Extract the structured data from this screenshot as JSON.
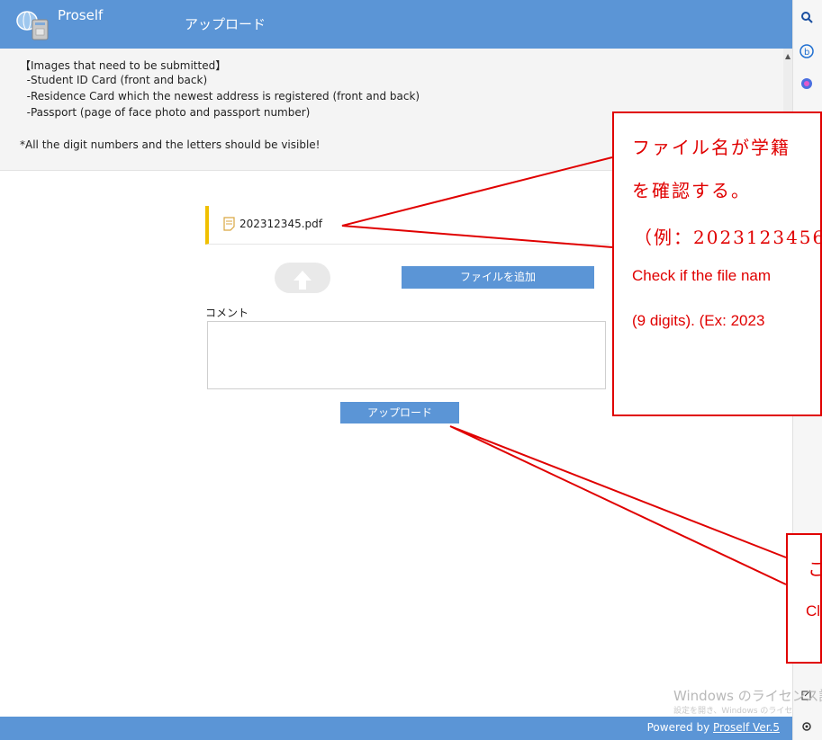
{
  "header": {
    "app_name": "Proself",
    "page_title": "アップロード"
  },
  "instructions": {
    "lines": [
      "【Images that need to be submitted】",
      "  -Student ID Card (front and back)",
      "  -Residence Card which the newest address is registered (front and back)",
      "  -Passport (page of face photo and passport number)",
      "",
      "*All the digit numbers and the letters should be visible!"
    ]
  },
  "file": {
    "name": "202312345.pdf"
  },
  "buttons": {
    "add_file": "ファイルを追加",
    "upload": "アップロード"
  },
  "comment": {
    "label": "コメント",
    "value": ""
  },
  "footer": {
    "powered_by": "Powered by ",
    "link": "Proself Ver.5"
  },
  "annotations": {
    "callout1": {
      "jp_line1": "ファイル名が学籍",
      "jp_line2": "を確認する。",
      "jp_line3": "（例：2023123456",
      "en_line1": "Check if the file nam",
      "en_line2": "(9 digits). (Ex: 2023"
    },
    "callout2": {
      "jp_line1": "こ",
      "en_line1": "Cl"
    }
  },
  "watermark": {
    "line1": "Windows のライセンス認",
    "line2": "設定を開き、Windows のライセ"
  },
  "sidebar_icons": [
    "search-icon",
    "bing-icon",
    "copilot-icon",
    "open-external-icon",
    "settings-icon"
  ],
  "colors": {
    "accent": "#5b95d6",
    "annotation": "#e00000",
    "file_marker": "#f0c000"
  }
}
